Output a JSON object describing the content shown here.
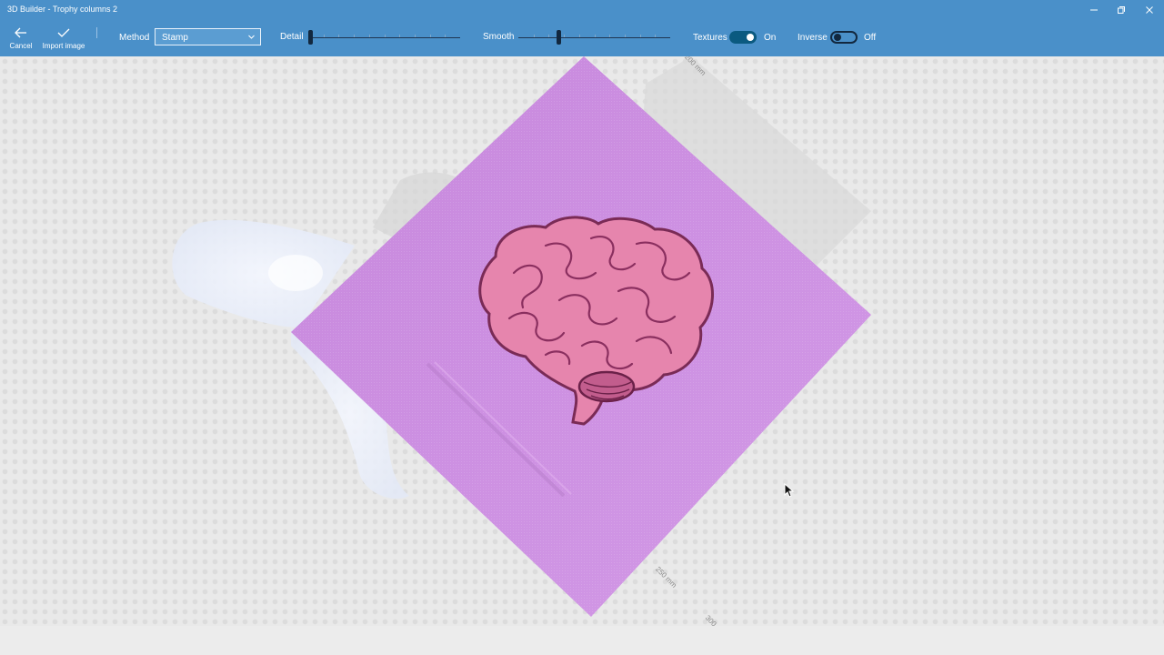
{
  "window": {
    "title": "3D Builder - Trophy columns 2"
  },
  "toolbar": {
    "cancel_label": "Cancel",
    "import_label": "Import image",
    "method": {
      "label": "Method",
      "value": "Stamp"
    },
    "detail": {
      "label": "Detail",
      "level": 0.0
    },
    "smooth": {
      "label": "Smooth",
      "level": 0.26
    },
    "textures": {
      "label": "Textures",
      "state": "On",
      "enabled": true
    },
    "inverse": {
      "label": "Inverse",
      "state": "Off",
      "enabled": false
    }
  },
  "viewport": {
    "ruler_labels": [
      "200 mm",
      "250 mm",
      "300"
    ],
    "stamp_color": "#cc8fe0",
    "brain_color": "#e685ad"
  },
  "icons": {
    "cancel": "back-arrow-icon",
    "import": "checkmark-icon",
    "dropdown": "chevron-down-icon",
    "minimize": "minimize-icon",
    "restore": "restore-icon",
    "close": "close-icon",
    "cursor": "mouse-pointer-icon"
  },
  "colors": {
    "titlebar": "#4a90c9",
    "toggle_on": "#0b5a80",
    "slider_thumb": "#12283f"
  }
}
